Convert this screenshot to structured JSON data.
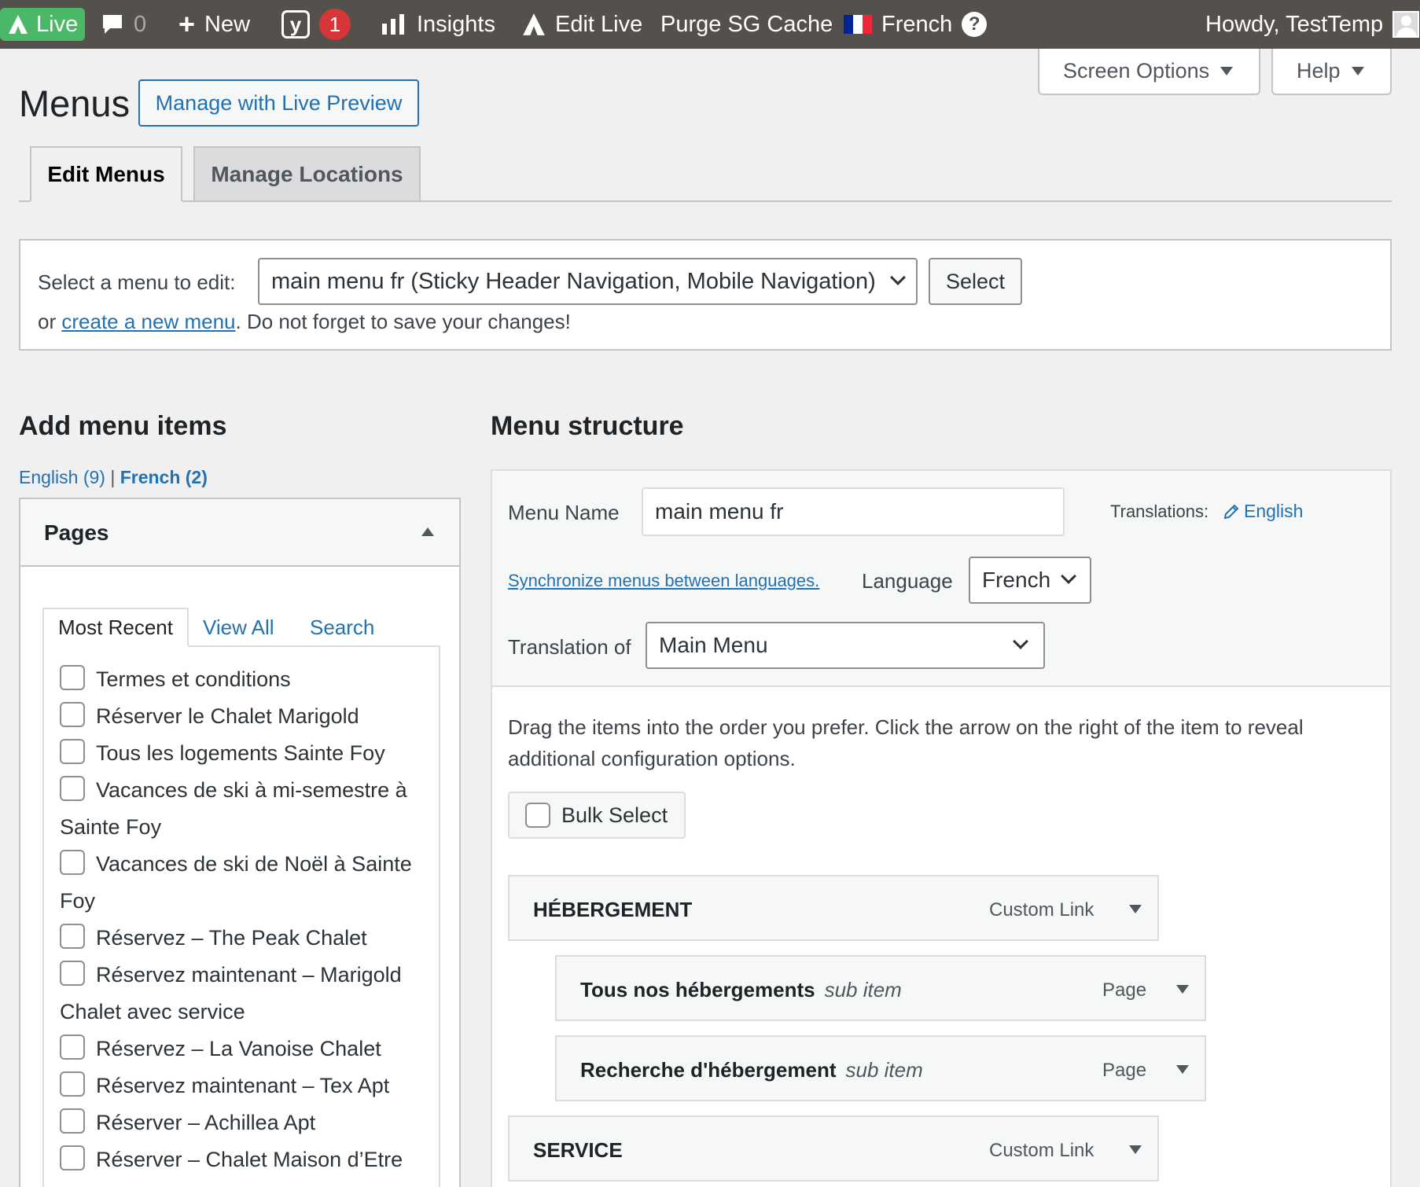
{
  "adminbar": {
    "live": "Live",
    "comments_count": "0",
    "new": "New",
    "yoast_badge": "1",
    "insights": "Insights",
    "edit_live": "Edit Live",
    "purge": "Purge SG Cache",
    "language": "French",
    "howdy": "Howdy, TestTemp",
    "colors": {
      "bar": "#54504c",
      "live": "#4ab866",
      "badge": "#d63638"
    }
  },
  "screen_options": "Screen Options",
  "help": "Help",
  "page_title": "Menus",
  "manage_live_preview": "Manage with Live Preview",
  "nav_tabs": {
    "edit": "Edit Menus",
    "locations": "Manage Locations"
  },
  "select_menu": {
    "label": "Select a menu to edit:",
    "selected": "main menu fr (Sticky Header Navigation, Mobile Navigation)",
    "button": "Select",
    "or": "or",
    "create_link": "create a new menu",
    "suffix": ". Do not forget to save your changes!"
  },
  "add_items": {
    "heading": "Add menu items",
    "lang_english": "English (9)",
    "separator": "|",
    "lang_french": "French (2)",
    "panel_title": "Pages",
    "tabs": {
      "recent": "Most Recent",
      "all": "View All",
      "search": "Search"
    },
    "pages": [
      "Termes et conditions",
      "Réserver le Chalet Marigold",
      "Tous les logements Sainte Foy",
      "Vacances de ski à mi-semestre à Sainte Foy",
      "Vacances de ski de Noël à Sainte Foy",
      "Réservez – The Peak Chalet",
      "Réservez maintenant – Marigold Chalet avec service",
      "Réservez – La Vanoise Chalet",
      "Réservez maintenant – Tex Apt",
      "Réserver – Achillea Apt",
      "Réserver – Chalet Maison d’Etre"
    ]
  },
  "structure": {
    "heading": "Menu structure",
    "menu_name_label": "Menu Name",
    "menu_name_value": "main menu fr",
    "translations_label": "Translations:",
    "translations_link": "English",
    "sync_link": "Synchronize menus between languages.",
    "language_label": "Language",
    "language_value": "French",
    "translation_of_label": "Translation of",
    "translation_of_value": "Main Menu",
    "drag_info": "Drag the items into the order you prefer. Click the arrow on the right of the item to reveal additional configuration options.",
    "bulk_select": "Bulk Select",
    "items": [
      {
        "title": "HÉBERGEMENT",
        "sub": "",
        "type": "Custom Link"
      },
      {
        "title": "Tous nos hébergements",
        "sub": "sub item",
        "type": "Page"
      },
      {
        "title": "Recherche d'hébergement",
        "sub": "sub item",
        "type": "Page"
      },
      {
        "title": "SERVICE",
        "sub": "",
        "type": "Custom Link"
      }
    ]
  }
}
